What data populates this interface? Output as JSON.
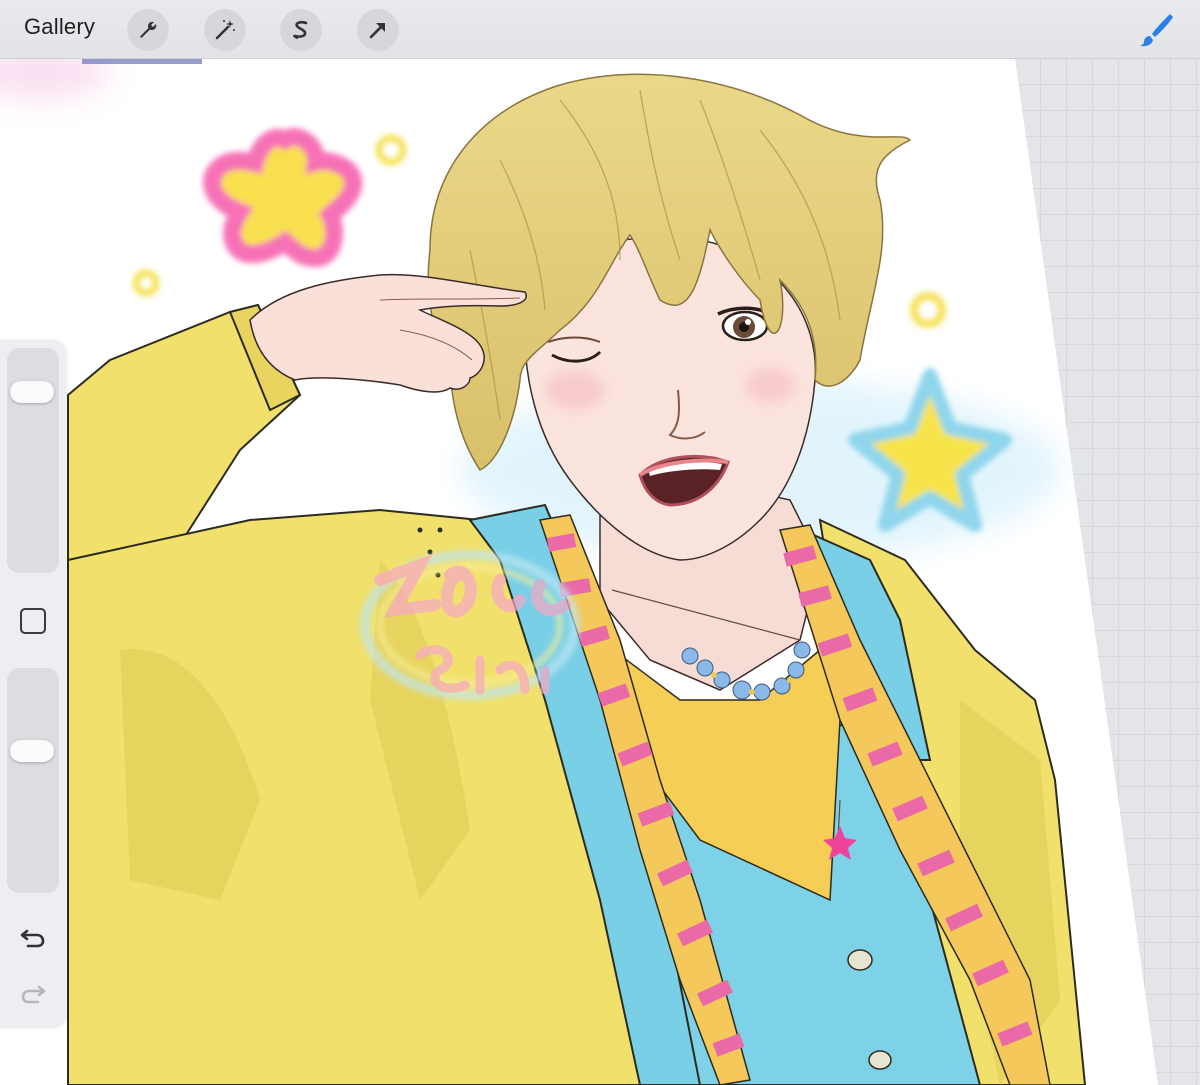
{
  "toolbar": {
    "gallery_label": "Gallery",
    "tools": [
      "wrench-icon",
      "magic-wand-icon",
      "selection-s-icon",
      "arrow-transform-icon"
    ],
    "active_tool": "brush-icon",
    "accent_color": "#2b7fe8"
  },
  "sidebar": {
    "brush_size_level": 0.85,
    "opacity_level": 0.65,
    "modify_button_icon": "square-icon",
    "undo_icon": "undo-icon",
    "redo_icon": "redo-icon"
  },
  "artwork": {
    "description_colors": {
      "hair": "#e8d27e",
      "jacket": "#f0e06a",
      "shirt": "#78cfe6",
      "stripe_pink": "#e56aa6",
      "star_pink": "#f576b4",
      "star_yellow": "#f8e24a",
      "star_blue": "#8fd6ec"
    }
  }
}
